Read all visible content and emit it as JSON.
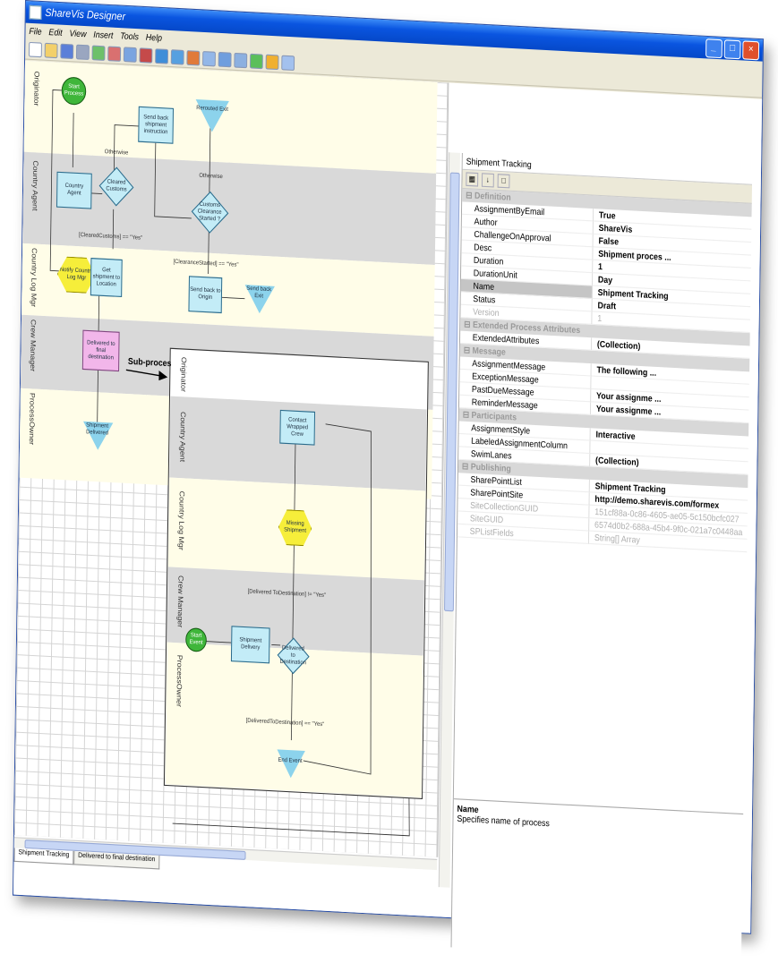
{
  "window": {
    "title": "ShareVis Designer"
  },
  "menu": [
    "File",
    "Edit",
    "View",
    "Insert",
    "Tools",
    "Help"
  ],
  "diagram": {
    "lanes": [
      "Originator",
      "Country Agent",
      "Country Log Mgr",
      "Crew Manager",
      "ProcessOwner"
    ],
    "shapes": {
      "start_process": "Start Process",
      "country_agent": "Country Agent",
      "cleared_customs": "Cleared Customs",
      "notify_country_log_mgr": "Notify Country Log Mgr",
      "get_shipment_to_location": "Get shipment to Location",
      "send_back_shipment_instruction": "Send back shipment instruction",
      "rerouted_exit": "Rerouted Exit",
      "customs_clearance_started": "Customs Clearance Started ?",
      "send_back_to_origin": "Send back to Origin",
      "send_back_exit": "Send back Exit",
      "delivered_to_final_destination": "Delivered to final destination",
      "shipment_delivered": "Shipment Delivered"
    },
    "conditions": {
      "otherwise_1": "Otherwise",
      "otherwise_2": "Otherwise",
      "cleared_customs_yes": "[ClearedCustoms] == \"Yes\"",
      "clearance_started_yes": "[ClearanceStarted] == \"Yes\""
    },
    "subprocess_label": "Sub-proces",
    "subprocess": {
      "lanes": [
        "Originator",
        "Country Agent",
        "Country Log Mgr",
        "Crew Manager",
        "ProcessOwner"
      ],
      "shapes": {
        "contact_wrapped_crew": "Contact Wrapped Crew",
        "missing_shipment": "Missing Shipment",
        "start_event": "Start Event",
        "shipment_delivery": "Shipment Delivery",
        "delivered_to_destination": "Delivered to Destination",
        "end_event": "End Event"
      },
      "conditions": {
        "delivered_destination_yes_a": "[Delivered ToDestination] != \"Yes\"",
        "delivered_destination_yes_b": "[DeliveredToDestination] == \"Yes\""
      }
    }
  },
  "tabs": [
    "Shipment Tracking",
    "Delivered to final destination"
  ],
  "properties": {
    "header": "Shipment Tracking",
    "rows": [
      {
        "type": "cat",
        "k": "Definition",
        "v": ""
      },
      {
        "type": "item",
        "k": "AssignmentByEmail",
        "v": "True"
      },
      {
        "type": "item",
        "k": "Author",
        "v": "ShareVis"
      },
      {
        "type": "item",
        "k": "ChallengeOnApproval",
        "v": "False"
      },
      {
        "type": "item",
        "k": "Desc",
        "v": "Shipment proces ..."
      },
      {
        "type": "item",
        "k": "Duration",
        "v": "1"
      },
      {
        "type": "item",
        "k": "DurationUnit",
        "v": "Day"
      },
      {
        "type": "sel",
        "k": "Name",
        "v": "Shipment Tracking"
      },
      {
        "type": "item",
        "k": "Status",
        "v": "Draft"
      },
      {
        "type": "dim",
        "k": "Version",
        "v": "1"
      },
      {
        "type": "cat",
        "k": "Extended Process Attributes",
        "v": ""
      },
      {
        "type": "item",
        "k": "ExtendedAttributes",
        "v": "(Collection)"
      },
      {
        "type": "cat",
        "k": "Message",
        "v": ""
      },
      {
        "type": "item",
        "k": "AssignmentMessage",
        "v": "The following ..."
      },
      {
        "type": "item",
        "k": "ExceptionMessage",
        "v": ""
      },
      {
        "type": "item",
        "k": "PastDueMessage",
        "v": "Your assignme ..."
      },
      {
        "type": "item",
        "k": "ReminderMessage",
        "v": "Your assignme ..."
      },
      {
        "type": "cat",
        "k": "Participants",
        "v": ""
      },
      {
        "type": "item",
        "k": "AssignmentStyle",
        "v": "Interactive"
      },
      {
        "type": "item",
        "k": "LabeledAssignmentColumn",
        "v": ""
      },
      {
        "type": "item",
        "k": "SwimLanes",
        "v": "(Collection)"
      },
      {
        "type": "cat",
        "k": "Publishing",
        "v": ""
      },
      {
        "type": "item",
        "k": "SharePointList",
        "v": "Shipment Tracking"
      },
      {
        "type": "item",
        "k": "SharePointSite",
        "v": "http://demo.sharevis.com/formex"
      },
      {
        "type": "dim",
        "k": "SiteCollectionGUID",
        "v": "151cf88a-0c86-4605-ae05-5c150bcfc027"
      },
      {
        "type": "dim",
        "k": "SiteGUID",
        "v": "6574d0b2-688a-45b4-9f0c-021a7c0448aa"
      },
      {
        "type": "dim",
        "k": "SPListFields",
        "v": "String[] Array"
      }
    ],
    "description": {
      "title": "Name",
      "text": "Specifies name of process"
    }
  }
}
